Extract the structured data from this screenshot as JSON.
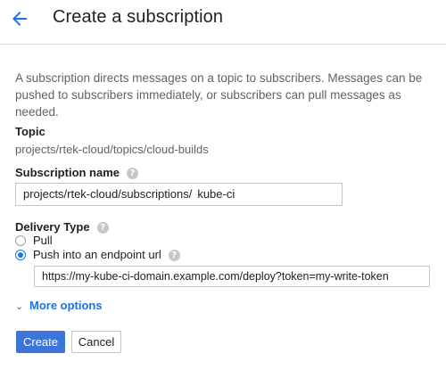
{
  "header": {
    "title": "Create a subscription",
    "back_icon": "arrow-back-icon"
  },
  "description": "A subscription directs messages on a topic to subscribers. Messages can be pushed to subscribers immediately, or subscribers can pull messages as needed.",
  "topic": {
    "label": "Topic",
    "value": "projects/rtek-cloud/topics/cloud-builds"
  },
  "subscription_name": {
    "label": "Subscription name",
    "prefix": "projects/rtek-cloud/subscriptions/",
    "value": "kube-ci"
  },
  "delivery_type": {
    "label": "Delivery Type",
    "options": [
      {
        "label": "Pull",
        "selected": false
      },
      {
        "label": "Push into an endpoint url",
        "selected": true
      }
    ]
  },
  "endpoint_url": {
    "value": "https://my-kube-ci-domain.example.com/deploy?token=my-write-token"
  },
  "more_options": {
    "label": "More options"
  },
  "actions": {
    "create_label": "Create",
    "cancel_label": "Cancel"
  },
  "colors": {
    "accent": "#1a73e8",
    "primary_button": "#3d74d9"
  }
}
